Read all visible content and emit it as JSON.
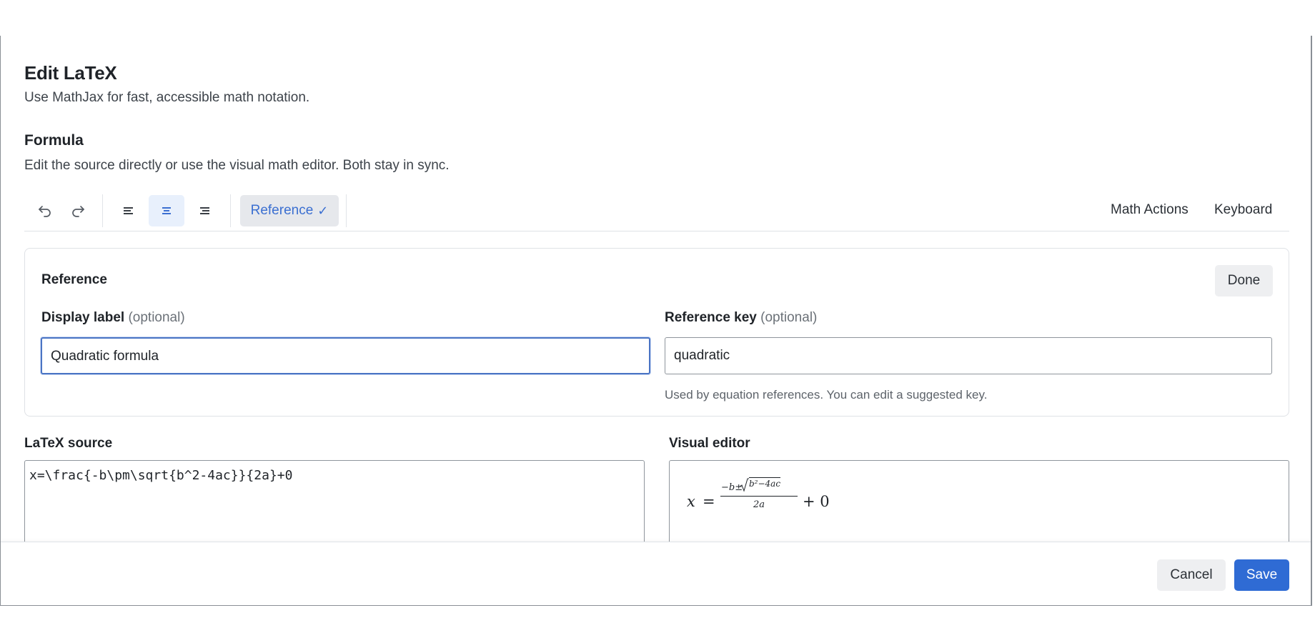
{
  "dialog": {
    "title": "Edit LaTeX",
    "subtitle": "Use MathJax for fast, accessible math notation."
  },
  "formula": {
    "title": "Formula",
    "description": "Edit the source directly or use the visual math editor. Both stay in sync."
  },
  "toolbar": {
    "undo_icon": "undo-icon",
    "redo_icon": "redo-icon",
    "align_left_icon": "align-left-icon",
    "align_center_icon": "align-center-icon",
    "align_right_icon": "align-right-icon",
    "active_alignment": "center",
    "reference_label": "Reference",
    "reference_check": "✓",
    "math_actions_label": "Math Actions",
    "keyboard_label": "Keyboard",
    "accent_color": "#3b6fd1"
  },
  "reference": {
    "title": "Reference",
    "done_label": "Done",
    "display_label": {
      "label": "Display label",
      "optional": "(optional)",
      "value": "Quadratic formula"
    },
    "reference_key": {
      "label": "Reference key",
      "optional": "(optional)",
      "value": "quadratic",
      "helper": "Used by equation references. You can edit a suggested key."
    }
  },
  "latex_source": {
    "label": "LaTeX source",
    "value": "x=\\frac{-b\\pm\\sqrt{b^2-4ac}}{2a}+0"
  },
  "visual_editor": {
    "label": "Visual editor",
    "render": {
      "lhs": "x",
      "equals": "=",
      "numerator_prefix": "−b±",
      "radicand": "b²−4ac",
      "denominator": "2a",
      "tail": "+ 0"
    }
  },
  "footer": {
    "cancel_label": "Cancel",
    "save_label": "Save",
    "primary_color": "#2f6bd4"
  }
}
